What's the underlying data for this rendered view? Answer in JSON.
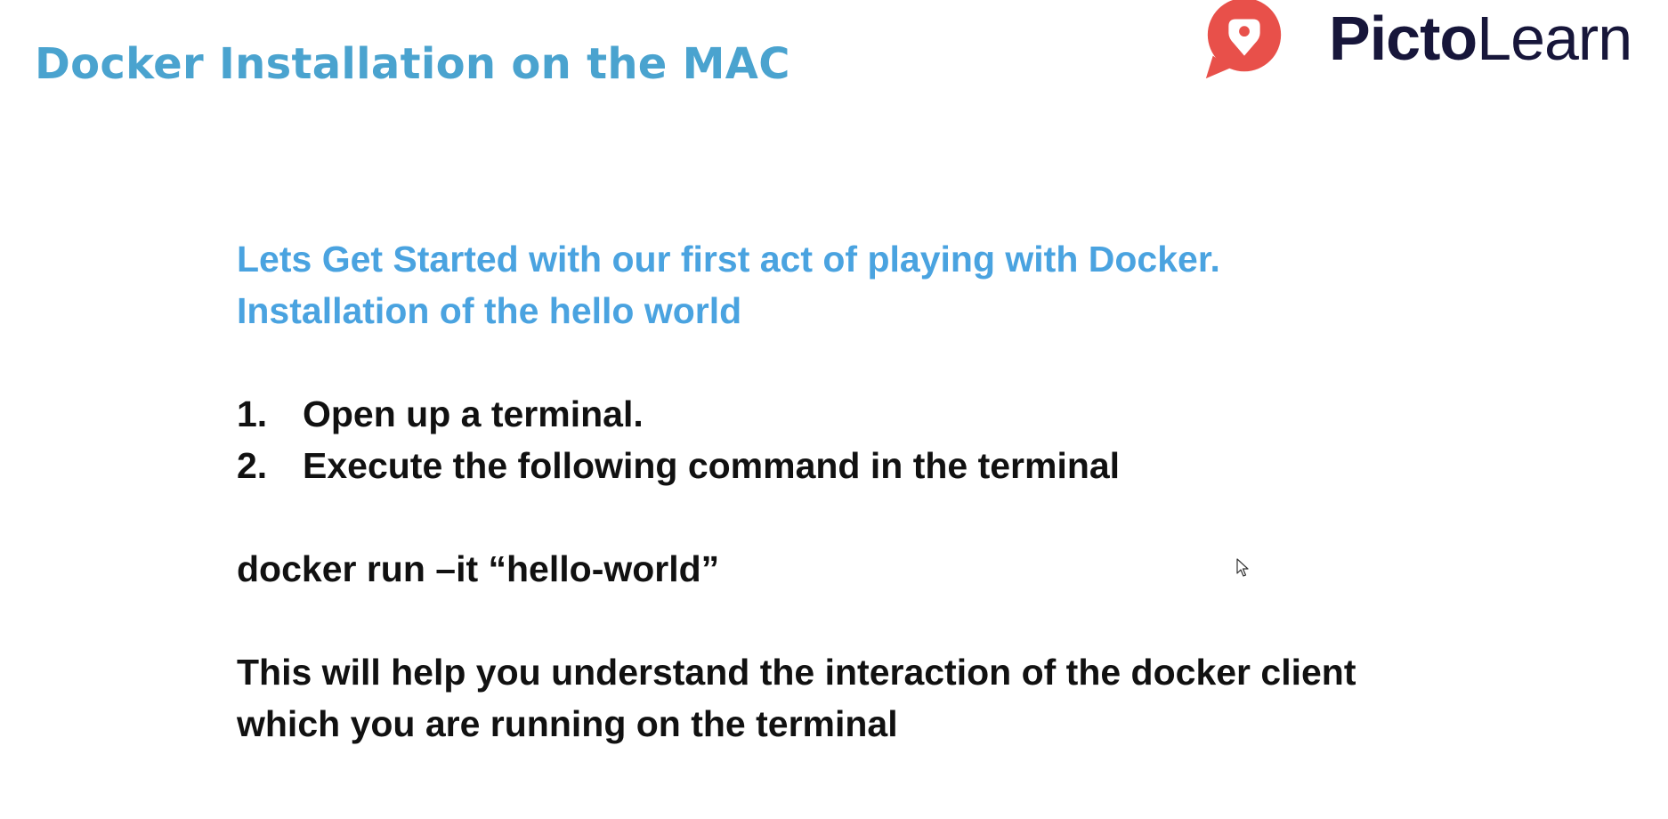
{
  "slide": {
    "title": "Docker Installation on the MAC",
    "logo": {
      "name_bold": "Picto",
      "name_light": "Learn",
      "brand_color": "#e8504a",
      "text_color": "#17163a",
      "icon": "map-pin-logo-icon"
    },
    "intro_lines": [
      "Lets Get Started with our first act of playing with Docker.",
      "Installation of the hello world"
    ],
    "steps": [
      {
        "number": "1.",
        "text": "Open up a terminal."
      },
      {
        "number": "2.",
        "text": "Execute the following command in the terminal"
      }
    ],
    "command": "docker run –it “hello-world”",
    "summary_lines": [
      "This will help you understand the interaction of the docker client",
      "which you are running on the terminal"
    ],
    "colors": {
      "title": "#4aa3cf",
      "intro": "#4aa3e0",
      "body": "#111111"
    },
    "cursor_icon": "mouse-pointer-icon"
  }
}
